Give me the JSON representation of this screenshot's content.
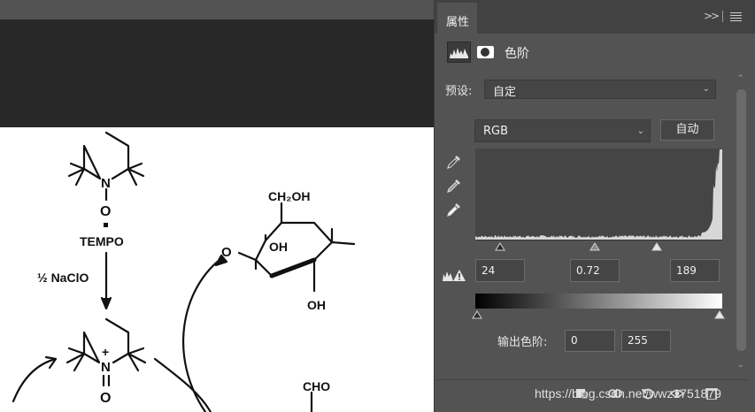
{
  "panel": {
    "tab_label": "属性",
    "collapse_icon": "double-chevron-right-icon",
    "menu_icon": "hamburger-menu-icon",
    "adjustment_title": "色阶",
    "preset_label": "预设:",
    "preset_value": "自定",
    "channel_value": "RGB",
    "auto_label": "自动",
    "input_levels": {
      "black": "24",
      "gamma": "0.72",
      "white": "189"
    },
    "output_label": "输出色阶:",
    "output_levels": {
      "black": "0",
      "white": "255"
    }
  },
  "histogram": {
    "black_point": 24,
    "white_point": 189,
    "gamma": 0.72
  },
  "document": {
    "labels": {
      "tempo": "TEMPO",
      "naclo": "½ NaClO",
      "n_top": "N",
      "o_top": "O",
      "n_bottom": "N",
      "plus": "+",
      "o_bottom": "O",
      "ch2oh": "CH₂OH",
      "oh_ring": "OH",
      "oh_bottom": "OH",
      "o_left": "O",
      "cho": "CHO"
    }
  },
  "watermark": "https://blog.csdn.net/wwz1751879",
  "colors": {
    "panel_bg": "#535353",
    "titlebar_bg": "#424242",
    "field_bg": "#454545",
    "dark_area": "#282828"
  }
}
